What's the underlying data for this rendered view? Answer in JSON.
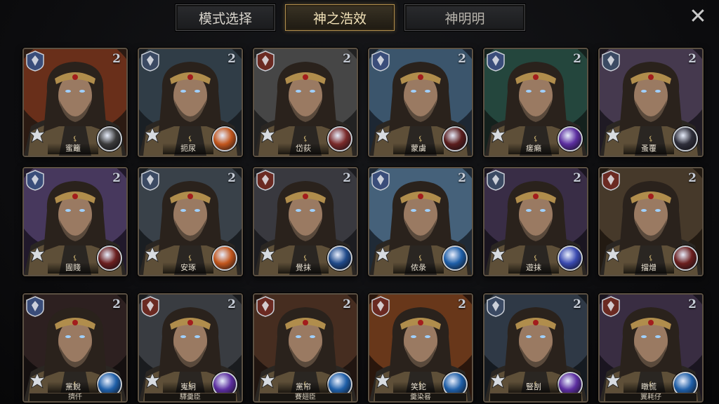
{
  "tabs": [
    {
      "label": "模式选择",
      "active": false
    },
    {
      "label": "神之浩效",
      "active": true
    },
    {
      "label": "神明明",
      "active": false
    }
  ],
  "close_glyph": "✕",
  "accent_color": "#b08d4c",
  "rows": [
    [
      {
        "name": "蜜籬",
        "level": "2",
        "rank_color": "#3a4d7a",
        "art": [
          "#8a3a1e",
          "#2b1a12"
        ],
        "skill_icon": "shield-emblem-icon",
        "skill_color": "#3a3a3a",
        "portrait": "horned-gold-helm-warrior"
      },
      {
        "name": "扼尿",
        "level": "2",
        "rank_color": "#3b4a63",
        "art": [
          "#3c4f5a",
          "#1a1f24"
        ],
        "skill_icon": "fire-slash-icon",
        "skill_color": "#c2561d",
        "portrait": "dark-haired-bearded-man"
      },
      {
        "name": "岱荻",
        "level": "2",
        "rank_color": "#6b2a22",
        "art": [
          "#5a5a5a",
          "#222"
        ],
        "skill_icon": "crest-icon",
        "skill_color": "#7a2a2a",
        "portrait": "white-bearded-elder"
      },
      {
        "name": "蒙虜",
        "level": "2",
        "rank_color": "#3a4d7a",
        "art": [
          "#4c6f8c",
          "#1d2733"
        ],
        "skill_icon": "wing-crest-icon",
        "skill_color": "#5a1d1d",
        "portrait": "gold-helm-knight"
      },
      {
        "name": "瘥癩",
        "level": "2",
        "rank_color": "#3a4d7a",
        "art": [
          "#2d5a4e",
          "#14211d"
        ],
        "skill_icon": "purple-spear-icon",
        "skill_color": "#5c2ea0",
        "portrait": "green-haired-sorceress"
      },
      {
        "name": "蚤覆",
        "level": "2",
        "rank_color": "#3b4a63",
        "art": [
          "#5a4a66",
          "#1f1a24"
        ],
        "skill_icon": "rune-icon",
        "skill_color": "#2e2e3a",
        "portrait": "one-eyed-horned-helm-warrior"
      }
    ],
    [
      {
        "name": "圊賤",
        "level": "2",
        "rank_color": "#3a4d7a",
        "art": [
          "#5c4a7a",
          "#20182a"
        ],
        "skill_icon": "crest-icon",
        "skill_color": "#6b1f1f",
        "portrait": "crowned-white-bearded-king"
      },
      {
        "name": "安琢",
        "level": "2",
        "rank_color": "#3b4a63",
        "art": [
          "#4a5560",
          "#1a1e22"
        ],
        "skill_icon": "fire-slash-icon",
        "skill_color": "#c2561d",
        "portrait": "glowing-eyed-warrior"
      },
      {
        "name": "覺抹",
        "level": "2",
        "rank_color": "#6b2a22",
        "art": [
          "#4a4a50",
          "#1c1c20"
        ],
        "skill_icon": "star-burst-icon",
        "skill_color": "#1f4a8a",
        "portrait": "masked-knight"
      },
      {
        "name": "侬彔",
        "level": "2",
        "rank_color": "#3a4d7a",
        "art": [
          "#5a7fa0",
          "#1f2a36"
        ],
        "skill_icon": "blue-spear-icon",
        "skill_color": "#1f5fa8",
        "portrait": "crowned-elder-king"
      },
      {
        "name": "遊抹",
        "level": "2",
        "rank_color": "#3b4a63",
        "art": [
          "#4a3a5a",
          "#1a1520"
        ],
        "skill_icon": "blue-spear-icon",
        "skill_color": "#3a4ab0",
        "portrait": "long-haired-rogue"
      },
      {
        "name": "擋熷",
        "level": "2",
        "rank_color": "#6b2a22",
        "art": [
          "#5a4a38",
          "#221a12"
        ],
        "skill_icon": "crest-icon",
        "skill_color": "#6b1f1f",
        "portrait": "armored-soldier"
      }
    ],
    [
      {
        "name": "黨銳",
        "sub": "擠仟",
        "level": "2",
        "rank_color": "#3a4d7a",
        "art": [
          "#3a2a2a",
          "#140f0f"
        ],
        "skill_icon": "blue-spear-icon",
        "skill_color": "#1f5fa8",
        "portrait": "crowned-dark-king"
      },
      {
        "name": "嵬絅",
        "sub": "驛羹臣",
        "level": "2",
        "rank_color": "#6b2a22",
        "art": [
          "#4a4f55",
          "#1a1c1f"
        ],
        "skill_icon": "purple-spear-icon",
        "skill_color": "#5c2ea0",
        "portrait": "grey-haired-warrior"
      },
      {
        "name": "黨帘",
        "sub": "賽翅臣",
        "level": "2",
        "rank_color": "#6b2a22",
        "art": [
          "#5a3a2a",
          "#201510"
        ],
        "skill_icon": "blue-spear-icon",
        "skill_color": "#1f5fa8",
        "portrait": "bearded-barbarian"
      },
      {
        "name": "笑鉈",
        "sub": "羹染晷",
        "level": "2",
        "rank_color": "#6b2a22",
        "art": [
          "#8a4a22",
          "#2a160c"
        ],
        "skill_icon": "blue-spear-icon",
        "skill_color": "#1f5fa8",
        "portrait": "gold-crowned-helm-king"
      },
      {
        "name": "豎剖",
        "sub": "",
        "level": "2",
        "rank_color": "#3b4a63",
        "art": [
          "#3d4a5a",
          "#151a20"
        ],
        "skill_icon": "purple-spear-icon",
        "skill_color": "#5c2ea0",
        "portrait": "blue-skinned-frost-giant"
      },
      {
        "name": "暾慌",
        "sub": "翼耗仔",
        "level": "2",
        "rank_color": "#6b2a22",
        "art": [
          "#4a3a55",
          "#1a1520"
        ],
        "skill_icon": "blue-spear-icon",
        "skill_color": "#1f5fa8",
        "portrait": "hooded-scarred-warrior"
      }
    ]
  ]
}
